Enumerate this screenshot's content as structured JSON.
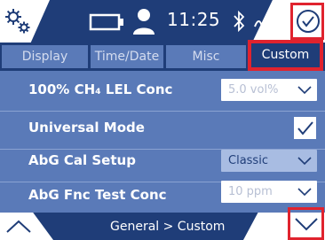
{
  "status": {
    "time": "11:25",
    "icons": [
      "gear-icon",
      "battery-icon",
      "person-icon",
      "bluetooth-icon",
      "antenna-icon",
      "check-circle-icon"
    ]
  },
  "tabs": [
    {
      "label": "Display",
      "active": false
    },
    {
      "label": "Time/Date",
      "active": false
    },
    {
      "label": "Misc",
      "active": false
    },
    {
      "label": "Custom",
      "active": true
    }
  ],
  "rows": [
    {
      "label": "100% CH₄ LEL Conc",
      "control": "select",
      "value": "5.0 vol%",
      "enabled": false
    },
    {
      "label": "Universal Mode",
      "control": "checkbox",
      "checked": true
    },
    {
      "label": "AbG Cal Setup",
      "control": "select",
      "value": "Classic",
      "enabled": true
    },
    {
      "label": "AbG Fnc Test Conc",
      "control": "select",
      "value": "10 ppm",
      "enabled": false
    }
  ],
  "footer": {
    "breadcrumb": "General > Custom",
    "icons": [
      "chevron-up-icon",
      "chevron-down-icon"
    ]
  },
  "colors": {
    "bar": "#1f3d78",
    "panel": "#5a7ab8",
    "highlight": "#e0232e"
  }
}
